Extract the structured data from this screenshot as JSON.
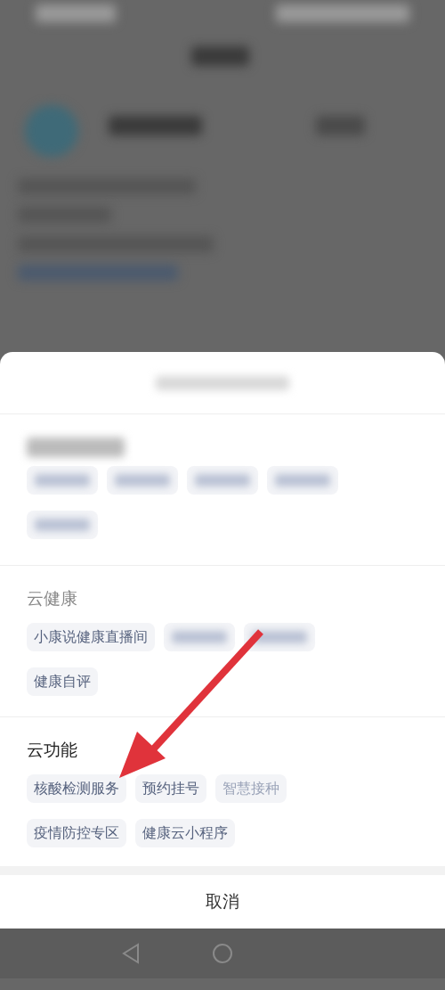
{
  "sections": [
    {
      "rows": [
        [
          {
            "kind": "blurred"
          },
          {
            "kind": "blurred"
          },
          {
            "kind": "blurred"
          },
          {
            "kind": "blurred"
          }
        ],
        [
          {
            "kind": "blurred"
          }
        ]
      ]
    },
    {
      "title": "云健康",
      "rows": [
        [
          {
            "kind": "text",
            "label": "小康说健康直播间"
          },
          {
            "kind": "blurred"
          },
          {
            "kind": "blurred"
          }
        ],
        [
          {
            "kind": "text",
            "label": "健康自评"
          }
        ]
      ]
    },
    {
      "title": "云功能",
      "rows": [
        [
          {
            "kind": "text",
            "label": "核酸检测服务"
          },
          {
            "kind": "text",
            "label": "预约挂号"
          },
          {
            "kind": "faded",
            "label": "智慧接种"
          }
        ],
        [
          {
            "kind": "text",
            "label": "疫情防控专区"
          },
          {
            "kind": "text",
            "label": "健康云小程序"
          }
        ]
      ]
    }
  ],
  "cancel": "取消"
}
